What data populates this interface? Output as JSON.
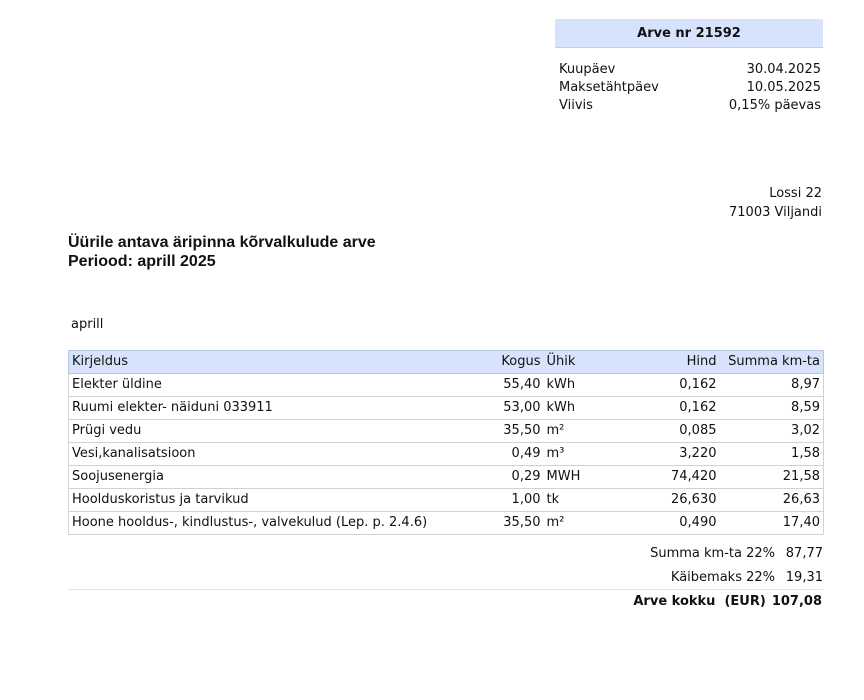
{
  "invoice": {
    "title": "Arve nr 21592",
    "meta": [
      {
        "label": "Kuupäev",
        "value": "30.04.2025"
      },
      {
        "label": "Maksetähtpäev",
        "value": "10.05.2025"
      },
      {
        "label": "Viivis",
        "value": "0,15% päevas"
      }
    ]
  },
  "address": {
    "line1": "Lossi 22",
    "line2": "71003 Viljandi"
  },
  "document": {
    "title_line1": "Üürile antava äripinna kõrvalkulude arve",
    "title_line2": "Periood: aprill 2025",
    "month_label": "aprill"
  },
  "table": {
    "headers": {
      "description": "Kirjeldus",
      "quantity": "Kogus",
      "unit": "Ühik",
      "price": "Hind",
      "amount": "Summa km-ta"
    },
    "rows": [
      {
        "description": "Elekter üldine",
        "quantity": "55,40",
        "unit": "kWh",
        "price": "0,162",
        "amount": "8,97"
      },
      {
        "description": "Ruumi elekter-  näiduni 033911",
        "quantity": "53,00",
        "unit": "kWh",
        "price": "0,162",
        "amount": "8,59"
      },
      {
        "description": "Prügi vedu",
        "quantity": "35,50",
        "unit": "m²",
        "price": "0,085",
        "amount": "3,02"
      },
      {
        "description": "Vesi,kanalisatsioon",
        "quantity": "0,49",
        "unit": "m³",
        "price": "3,220",
        "amount": "1,58"
      },
      {
        "description": "Soojusenergia",
        "quantity": "0,29",
        "unit": "MWH",
        "price": "74,420",
        "amount": "21,58"
      },
      {
        "description": "Hoolduskoristus ja tarvikud",
        "quantity": "1,00",
        "unit": "tk",
        "price": "26,630",
        "amount": "26,63"
      },
      {
        "description": "Hoone hooldus-, kindlustus-, valvekulud (Lep. p. 2.4.6)",
        "quantity": "35,50",
        "unit": "m²",
        "price": "0,490",
        "amount": "17,40"
      }
    ]
  },
  "totals": {
    "subtotal_label": "Summa km-ta 22%",
    "subtotal_value": "87,77",
    "vat_label": "Käibemaks 22%",
    "vat_value": "19,31",
    "grand_total_label": "Arve kokku  (EUR)",
    "grand_total_value": "107,08"
  }
}
